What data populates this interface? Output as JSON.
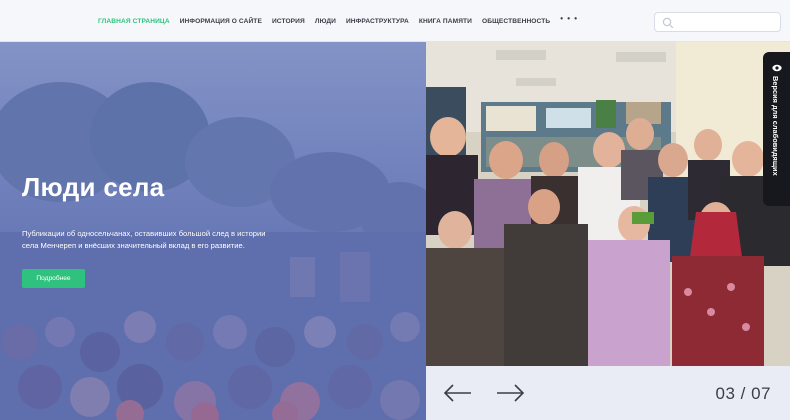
{
  "nav": {
    "items": [
      {
        "label": "Главная страница",
        "active": true
      },
      {
        "label": "Информация о сайте",
        "active": false
      },
      {
        "label": "История",
        "active": false
      },
      {
        "label": "Люди",
        "active": false
      },
      {
        "label": "Инфраструктура",
        "active": false
      },
      {
        "label": "Книга памяти",
        "active": false
      },
      {
        "label": "Общественность",
        "active": false
      }
    ],
    "more": "• • •",
    "accent_color": "#2ec27e"
  },
  "search": {
    "placeholder": "",
    "value": "",
    "icon": "search-icon"
  },
  "hero": {
    "title": "Люди села",
    "description": "Публикации об односельчанах, оставивших большой след в истории села Менчереп и внёсших значительный вклад в его развитие.",
    "button_label": "Подробнее"
  },
  "accessibility": {
    "label": "Версия для слабовидящих",
    "icon": "eye-icon"
  },
  "slider": {
    "counter": "03 / 07",
    "prev_icon": "arrow-left-icon",
    "next_icon": "arrow-right-icon"
  }
}
